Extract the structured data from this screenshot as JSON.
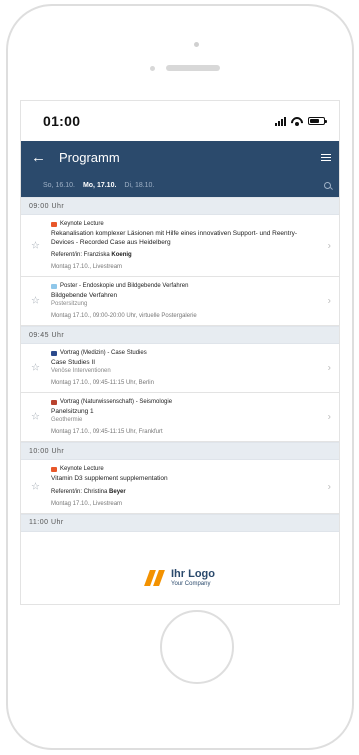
{
  "status": {
    "time": "01:00"
  },
  "header": {
    "title": "Programm",
    "back_icon": "arrow-left-icon",
    "menu_icon": "hamburger-menu-icon"
  },
  "dates": [
    {
      "day": "So,",
      "date": "16.10.",
      "active": false
    },
    {
      "day": "Mo,",
      "date": "17.10.",
      "active": true
    },
    {
      "day": "Di,",
      "date": "18.10.",
      "active": false
    }
  ],
  "sections": [
    {
      "time": "09:00 Uhr",
      "items": [
        {
          "type": "Keynote Lecture",
          "badge_color": "#e8572a",
          "title": "Rekanalisation komplexer Läsionen mit Hilfe eines innovativen Support- und Reentry-Devices - Recorded Case aus Heidelberg",
          "subtitle": "",
          "speaker_prefix": "Referent/in: Franziska ",
          "speaker_name": "Koenig",
          "meta": "Montag 17.10., Livestream"
        },
        {
          "type": "Poster - Endoskopie und Bildgebende Verfahren",
          "badge_color": "#8fc7ea",
          "title": "Bildgebende Verfahren",
          "subtitle": "Postersitzung",
          "speaker_prefix": "",
          "speaker_name": "",
          "meta": "Montag 17.10., 09:00-20:00 Uhr, virtuelle Postergalerie"
        }
      ]
    },
    {
      "time": "09:45 Uhr",
      "items": [
        {
          "type": "Vortrag (Medizin) - Case Studies",
          "badge_color": "#2b4a8c",
          "title": "Case Studies II",
          "subtitle": "Venöse Interventionen",
          "speaker_prefix": "",
          "speaker_name": "",
          "meta": "Montag 17.10., 09:45-11:15 Uhr, Berlin"
        },
        {
          "type": "Vortrag (Naturwissenschaft) - Seismologie",
          "badge_color": "#b8422e",
          "title": "Panelsitzung 1",
          "subtitle": "Geothermie",
          "speaker_prefix": "",
          "speaker_name": "",
          "meta": "Montag 17.10., 09:45-11:15 Uhr, Frankfurt"
        }
      ]
    },
    {
      "time": "10:00 Uhr",
      "items": [
        {
          "type": "Keynote Lecture",
          "badge_color": "#e8572a",
          "title": "Vitamin D3 supplement supplementation",
          "subtitle": "",
          "speaker_prefix": "Referent/in: Christina ",
          "speaker_name": "Beyer",
          "meta": "Montag 17.10., Livestream"
        }
      ]
    },
    {
      "time": "11:00 Uhr",
      "items": []
    }
  ],
  "logo": {
    "name": "Ihr Logo",
    "tagline": "Your Company",
    "color": "#f39200"
  }
}
